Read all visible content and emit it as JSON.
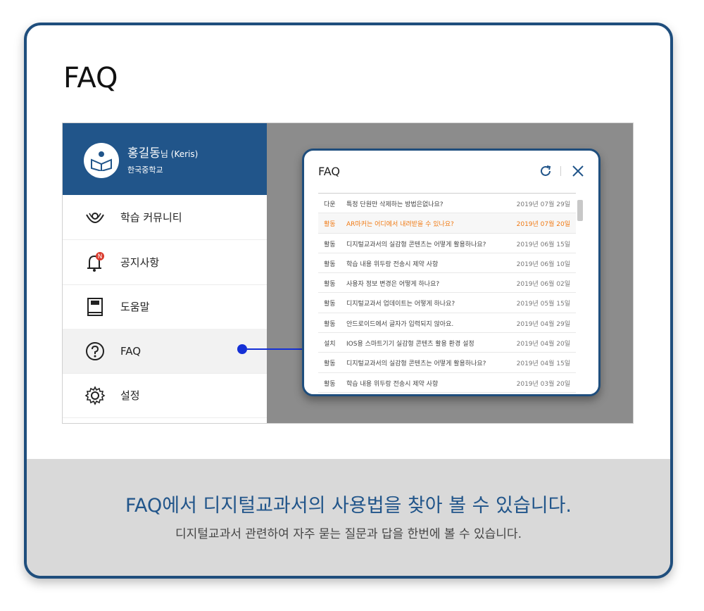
{
  "page": {
    "title": "FAQ"
  },
  "sidebar": {
    "user_name": "홍길동",
    "user_suffix": "님 (Keris)",
    "school": "한국중학교",
    "badge": "N",
    "items": [
      {
        "label": "학습 커뮤니티",
        "icon": "community-icon"
      },
      {
        "label": "공지사항",
        "icon": "bell-icon"
      },
      {
        "label": "도움말",
        "icon": "book-icon"
      },
      {
        "label": "FAQ",
        "icon": "question-icon"
      },
      {
        "label": "설정",
        "icon": "gear-icon"
      }
    ]
  },
  "popup": {
    "title": "FAQ",
    "rows": [
      {
        "cat": "다운",
        "q": "특정 단원만 삭제하는 방법은없나요?",
        "date": "2019년 07월 29일"
      },
      {
        "cat": "활동",
        "q": "AR마커는 어디에서 내려받을 수 있나요?",
        "date": "2019년 07월 20일",
        "highlight": true
      },
      {
        "cat": "활동",
        "q": "디지털교과서의 실감형 콘텐츠는 어떻게 활용하나요?",
        "date": "2019년 06월 15일"
      },
      {
        "cat": "활동",
        "q": "학습 내용 위두랑 전송시 제약 사항",
        "date": "2019년 06월 10일"
      },
      {
        "cat": "활동",
        "q": "사용자 정보 변경은 어떻게 하나요?",
        "date": "2019년 06월 02일"
      },
      {
        "cat": "활동",
        "q": "디지털교과서 업데이트는 어떻게 하나요?",
        "date": "2019년 05월 15일"
      },
      {
        "cat": "활동",
        "q": "안드로이드에서 글자가 입력되지 않아요.",
        "date": "2019년 04월 29일"
      },
      {
        "cat": "설치",
        "q": "IOS용 스마트기기 실감형 콘텐츠 활용 환경 설정",
        "date": "2019년 04월 20일"
      },
      {
        "cat": "활동",
        "q": "디지털교과서의 실감형 콘텐츠는 어떻게 활용하나요?",
        "date": "2019년 04월 15일"
      },
      {
        "cat": "활동",
        "q": "학습 내용 위두랑 전송시 제약 사항",
        "date": "2019년 03월 20일"
      }
    ]
  },
  "caption": {
    "headline": "FAQ에서 디지털교과서의 사용법을 찾아 볼 수 있습니다.",
    "sub": "디지털교과서 관련하여 자주 묻는 질문과 답을 한번에 볼 수 있습니다."
  },
  "colors": {
    "brand": "#21558a",
    "highlight": "#f07a14",
    "connector": "#1530d6"
  }
}
